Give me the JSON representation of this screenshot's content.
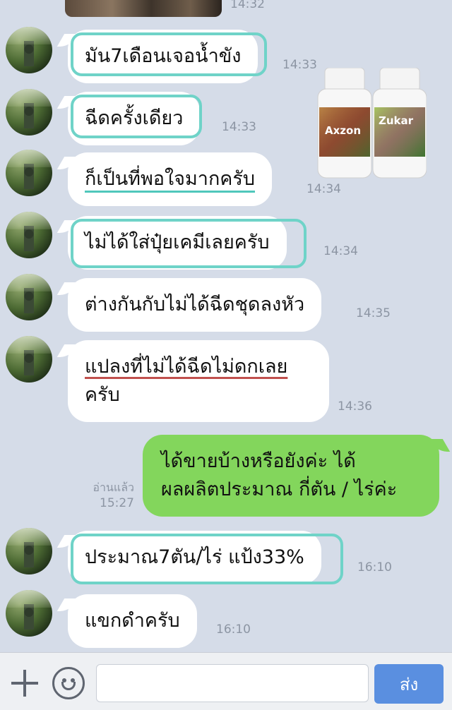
{
  "chat": {
    "top_time": "14:32",
    "messages": [
      {
        "side": "in",
        "text": "มัน7เดือนเจอน้ำขัง",
        "time": "14:33"
      },
      {
        "side": "in",
        "text": "ฉีดครั้งเดียว",
        "time": "14:33"
      },
      {
        "side": "in",
        "text": "ก็เป็นที่พอใจมากครับ",
        "time": "14:34"
      },
      {
        "side": "in",
        "text": "ไม่ได้ใส่ปุ๋ยเคมีเลยครับ",
        "time": "14:34"
      },
      {
        "side": "in",
        "text": "ต่างกันกับไม่ได้ฉีดชุดลงหัว",
        "time": "14:35"
      },
      {
        "side": "in",
        "line1": "แปลงที่ไม่ได้ฉีดไม่ดกเลย",
        "line2": "ครับ",
        "time": "14:36"
      },
      {
        "side": "out",
        "line1": "ได้ขายบ้างหรือยังค่ะ  ได้",
        "line2": "ผลผลิตประมาณ กี่ตัน / ไร่ค่ะ",
        "read_label": "อ่านแล้ว",
        "time": "15:27"
      },
      {
        "side": "in",
        "text": "ประมาณ7ตัน/ไร่  แป้ง33%",
        "time": "16:10"
      },
      {
        "side": "in",
        "text": "แขกดำครับ",
        "time": "16:10"
      }
    ],
    "product_image": {
      "bottle1_label": "Axzon",
      "bottle2_label": "Zukar"
    }
  },
  "input_bar": {
    "placeholder": "",
    "send_label": "ส่ง"
  },
  "colors": {
    "background": "#d5dce8",
    "incoming_bubble": "#ffffff",
    "outgoing_bubble": "#83d65c",
    "highlight_box": "#6fd3c8",
    "send_button": "#5a8fe0"
  }
}
